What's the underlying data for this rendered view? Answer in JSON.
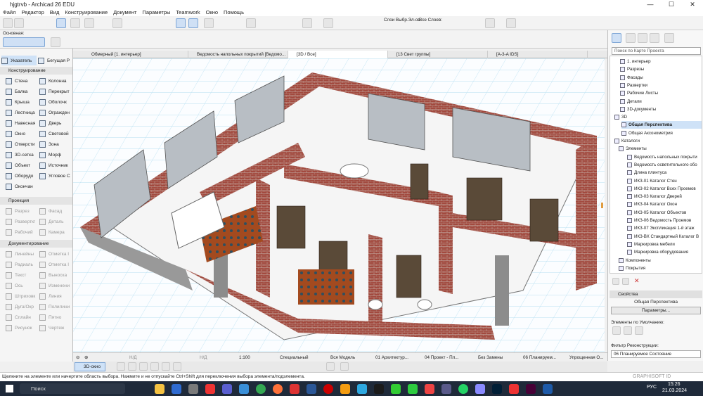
{
  "window": {
    "title": "hjgtrvb - Archicad 26 EDU",
    "minimize": "—",
    "maximize": "☐",
    "close": "✕"
  },
  "menu": [
    "Файл",
    "Редактор",
    "Вид",
    "Конструирование",
    "Документ",
    "Параметры",
    "Teamwork",
    "Окно",
    "Помощь"
  ],
  "toolbar": {
    "layer_combo_label": "Слои Выбр.Эл-ов",
    "all_layers_label": "Все Слоев:",
    "basic_label": "Основная:"
  },
  "toolbox": {
    "pointer": "Указатель",
    "marquee": "Бегущая Р",
    "sections": {
      "design": "Конструирование",
      "viewpoint": "Проекция",
      "document": "Документирование"
    },
    "design_tools": [
      "Стена",
      "Колонна",
      "Балка",
      "Перекрыт",
      "Крыша",
      "Оболочк",
      "Лестница",
      "Огражден",
      "Навесная",
      "Дверь",
      "Окно",
      "Световой",
      "Отверсти",
      "Зона",
      "3D-сетка",
      "Морф",
      "Объект",
      "Источник",
      "Оборудо",
      "Угловое С",
      "Окончан"
    ],
    "viewpoint_tools": [
      "Разрез",
      "Фасад",
      "Разверткг",
      "Деталь",
      "Рабочий",
      "Камера"
    ],
    "document_tools": [
      "Линейны",
      "Отметка I",
      "Радиаль",
      "Отметка I",
      "Текст",
      "Выноска",
      "Ось",
      "Изменени",
      "Штриховк",
      "Линия",
      "Дуга/Окр",
      "Полилини",
      "Сплайн",
      "Пятно",
      "Рисунок",
      "Чертеж"
    ]
  },
  "tabs": [
    "Обмерный [1. интерьер]",
    "Ведомость напольных покрытий [Ведомо...",
    "[3D / Все]",
    "[13 Свет группы]",
    "[A-3-A IDS]"
  ],
  "viewport_status": {
    "scale": "1:100",
    "special": "Специальный",
    "model": "Вся Модель",
    "arch": "01 Архитектур...",
    "project": "04 Проект - Пл...",
    "no_replace": "Без Замены",
    "planned": "06 Планируем...",
    "simplified": "Упрощенная О...",
    "nd1": "Н/Д",
    "nd2": "Н/Д"
  },
  "viewbar": {
    "view_3d": "3D-окно"
  },
  "navigator": {
    "search_placeholder": "Поиск по Карте Проекта",
    "items": [
      "1. интерьер",
      "Разрезы",
      "Фасады",
      "Развертки",
      "Рабочие Листы",
      "Детали",
      "3D-документы",
      "3D",
      "Общая Перспектива",
      "Общая Аксонометрия",
      "Каталоги",
      "Элементы",
      "Ведомость напольных покрыти",
      "Ведомость осветительного обо",
      "Длина плинтуса",
      "ИКЗ-01 Каталог Стен",
      "ИКЗ-02 Каталог Всех Проемов",
      "ИКЗ-03 Каталог Дверей",
      "ИКЗ-04 Каталог Окон",
      "ИКЗ-05 Каталог Объектов",
      "ИКЗ-06 Ведомость Проемов",
      "ИКЗ-07 Экспликация 1-й этаж",
      "ИКЗ-ВХ Стандартный Каталог В",
      "Маркировка мебели",
      "Маркировка оборудования",
      "Компоненты",
      "Покрытия"
    ],
    "selected": "Общая Перспектива"
  },
  "properties": {
    "header": "Свойства",
    "name": "Общая Перспектива",
    "params_button": "Параметры...",
    "defaults_label": "Элементы по Умолчанию:",
    "renovation_label": "Фильтр Реконструкции:",
    "renovation_value": "06 Планируемое Состояние"
  },
  "statusbar": {
    "hint": "Щелкните на элементе или начертите область выбора. Нажмите и не отпускайте Ctrl+Shift для переключения выбора элемента/подэлемента."
  },
  "watermark": "GRAPHISOFT ID",
  "taskbar": {
    "search": "Поиск",
    "lang": "РУС",
    "time": "15:26",
    "date": "21.03.2024"
  }
}
